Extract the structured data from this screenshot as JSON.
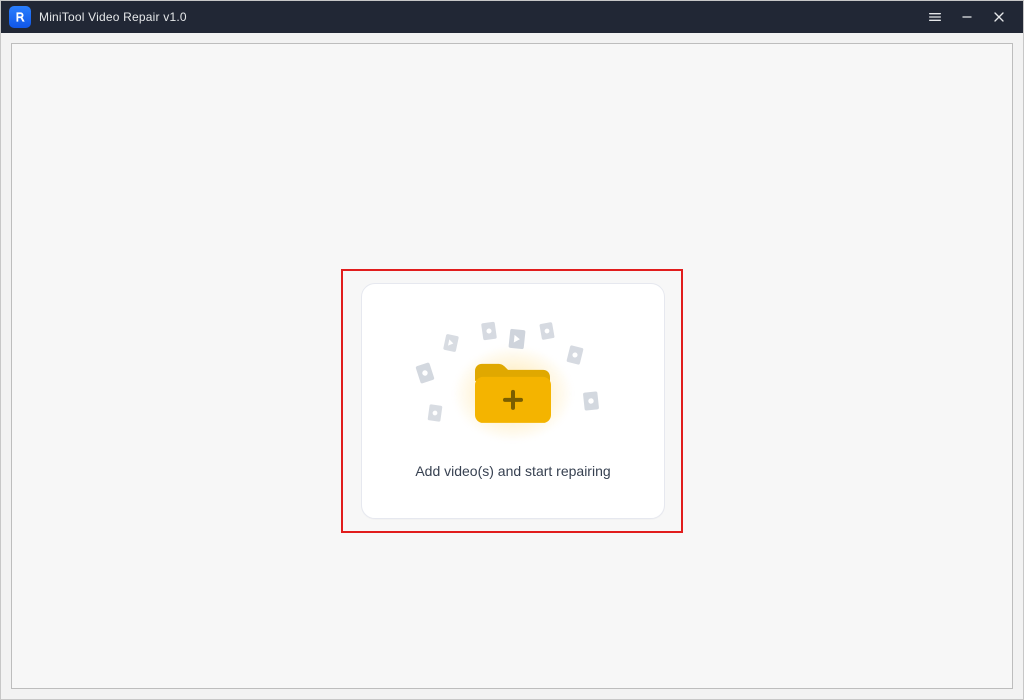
{
  "app": {
    "title": "MiniTool Video Repair v1.0",
    "logo_letter": "R",
    "brand_colors": {
      "titlebar_bg": "#212735",
      "accent_blue": "#1156e6",
      "folder": "#f4b400"
    }
  },
  "titlebar": {
    "menu_icon": "menu-icon",
    "minimize_icon": "minimize-icon",
    "close_icon": "close-icon"
  },
  "drop": {
    "caption": "Add video(s) and start repairing",
    "folder_icon": "folder-plus-icon"
  },
  "annotation": {
    "type": "highlight-rectangle",
    "color": "#e11d1d"
  }
}
